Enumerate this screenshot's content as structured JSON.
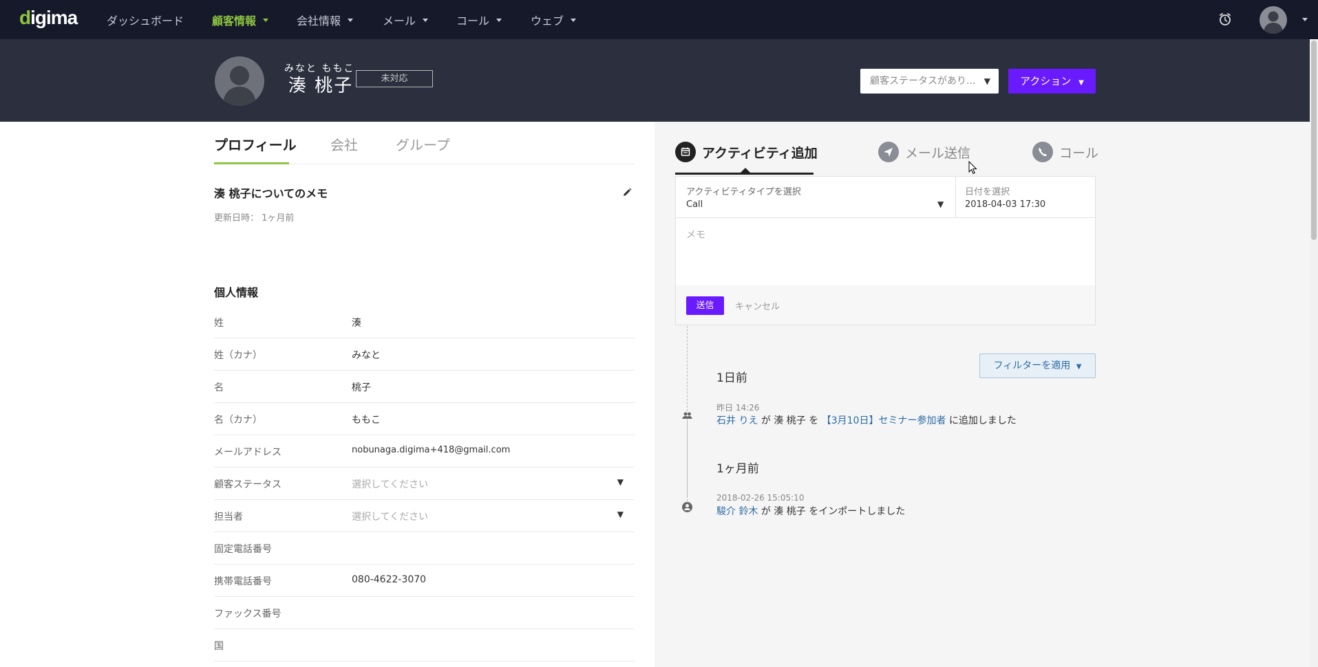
{
  "nav": {
    "logo": "digima",
    "items": [
      {
        "label": "ダッシュボード",
        "caret": false,
        "active": false
      },
      {
        "label": "顧客情報",
        "caret": true,
        "active": true
      },
      {
        "label": "会社情報",
        "caret": true,
        "active": false
      },
      {
        "label": "メール",
        "caret": true,
        "active": false
      },
      {
        "label": "コール",
        "caret": true,
        "active": false
      },
      {
        "label": "ウェブ",
        "caret": true,
        "active": false
      }
    ],
    "icons": [
      "alarm-icon",
      "user-avatar"
    ],
    "accent_color": "#8dc63f",
    "background_color": "#16192a"
  },
  "header": {
    "name_kana": "みなと ももこ",
    "name": "湊 桃子",
    "status_badge": "未対応",
    "status_select_placeholder": "顧客ステータスがあり...",
    "action_button": "アクション",
    "background_color": "#2b2f3e",
    "action_color": "#6a1aff"
  },
  "left": {
    "tabs": [
      "プロフィール",
      "会社",
      "グループ"
    ],
    "active_tab": "プロフィール",
    "memo_title": "湊 桃子についてのメモ",
    "memo_updated": "更新日時： 1ヶ月前",
    "section_title": "個人情報",
    "fields": [
      {
        "label": "姓",
        "value": "湊",
        "placeholder": false,
        "dropdown": false
      },
      {
        "label": "姓（カナ）",
        "value": "みなと",
        "placeholder": false,
        "dropdown": false
      },
      {
        "label": "名",
        "value": "桃子",
        "placeholder": false,
        "dropdown": false
      },
      {
        "label": "名（カナ）",
        "value": "ももこ",
        "placeholder": false,
        "dropdown": false
      },
      {
        "label": "メールアドレス",
        "value": "nobunaga.digima+418@gmail.com",
        "placeholder": false,
        "dropdown": false
      },
      {
        "label": "顧客ステータス",
        "value": "選択してください",
        "placeholder": true,
        "dropdown": true
      },
      {
        "label": "担当者",
        "value": "選択してください",
        "placeholder": true,
        "dropdown": true
      },
      {
        "label": "固定電話番号",
        "value": "",
        "placeholder": false,
        "dropdown": false
      },
      {
        "label": "携帯電話番号",
        "value": "080-4622-3070",
        "placeholder": false,
        "dropdown": false
      },
      {
        "label": "ファックス番号",
        "value": "",
        "placeholder": false,
        "dropdown": false
      },
      {
        "label": "国",
        "value": "",
        "placeholder": false,
        "dropdown": false
      }
    ]
  },
  "right": {
    "tabs": [
      {
        "label": "アクティビティ追加",
        "icon": "calendar-icon",
        "active": true
      },
      {
        "label": "メール送信",
        "icon": "send-icon",
        "active": false
      },
      {
        "label": "コール",
        "icon": "phone-icon",
        "active": false
      }
    ],
    "form": {
      "type_label": "アクティビティタイプを選択",
      "type_value": "Call",
      "date_label": "日付を選択",
      "date_value": "2018-04-03 17:30",
      "memo_placeholder": "メモ",
      "send_button": "送信",
      "cancel_button": "キャンセル"
    },
    "filter_button": "フィルターを適用",
    "timeline": [
      {
        "heading": "1日前",
        "entries": [
          {
            "time": "昨日 14:26",
            "icon": "group-icon",
            "actor": "石井 りえ",
            "text1": " が 湊 桃子 を ",
            "target": "【3月10日】セミナー参加者",
            "text2": " に追加しました"
          }
        ]
      },
      {
        "heading": "1ヶ月前",
        "entries": [
          {
            "time": "2018-02-26 15:05:10",
            "icon": "person-circle-icon",
            "actor": "駿介 鈴木",
            "text1": " が 湊 桃子 をインポートしました",
            "target": "",
            "text2": ""
          }
        ]
      }
    ]
  }
}
